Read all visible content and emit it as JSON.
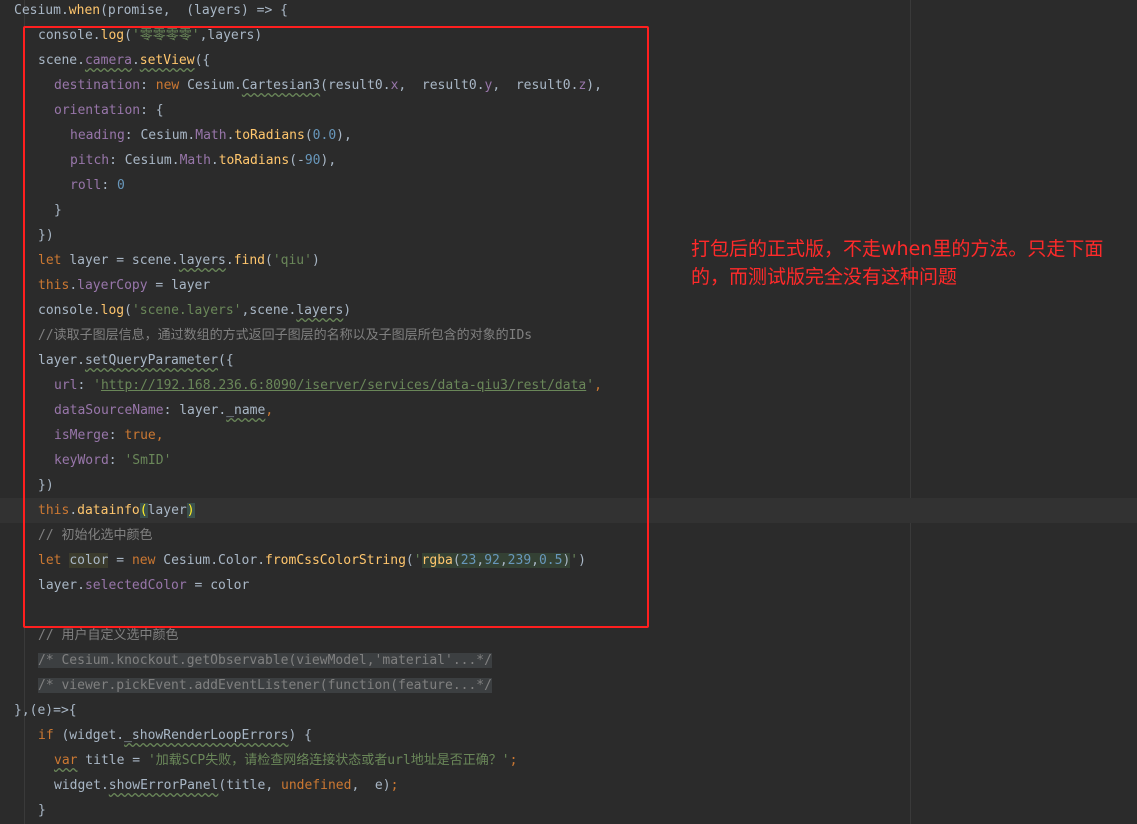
{
  "colors": {
    "background": "#2b2b2b",
    "default": "#a9b7c6",
    "keyword": "#cc7832",
    "string": "#6a8759",
    "number": "#6897bb",
    "method": "#ffc66d",
    "property": "#9876aa",
    "comment": "#808080",
    "annotation": "#ff2a2a",
    "highlight_box": "#ff1f1f"
  },
  "annotation": {
    "text": "打包后的正式版，不走when里的方法。只走下面的，而测试版完全没有这种问题"
  },
  "code_lines": [
    {
      "indent": 1,
      "caret": false,
      "tokens": [
        {
          "t": "Cesium.",
          "c": "default"
        },
        {
          "t": "when",
          "c": "method"
        },
        {
          "t": "(promise,  (layers) => {",
          "c": "default"
        }
      ]
    },
    {
      "indent": 4,
      "caret": false,
      "tokens": [
        {
          "t": "console.",
          "c": "default"
        },
        {
          "t": "log",
          "c": "method"
        },
        {
          "t": "(",
          "c": "default"
        },
        {
          "t": "'零零零零'",
          "c": "string"
        },
        {
          "t": ",layers)",
          "c": "default"
        }
      ]
    },
    {
      "indent": 4,
      "caret": false,
      "tokens": [
        {
          "t": "scene.",
          "c": "default"
        },
        {
          "t": "camera",
          "c": "prop",
          "x": "typo"
        },
        {
          "t": ".",
          "c": "default"
        },
        {
          "t": "setView",
          "c": "method",
          "x": "typo"
        },
        {
          "t": "({",
          "c": "default"
        }
      ]
    },
    {
      "indent": 6,
      "caret": false,
      "tokens": [
        {
          "t": "destination",
          "c": "prop"
        },
        {
          "t": ": ",
          "c": "default"
        },
        {
          "t": "new ",
          "c": "keyword"
        },
        {
          "t": "Cesium.",
          "c": "default"
        },
        {
          "t": "Cartesian3",
          "c": "default",
          "x": "typo"
        },
        {
          "t": "(result0.",
          "c": "default"
        },
        {
          "t": "x",
          "c": "prop"
        },
        {
          "t": ",  result0.",
          "c": "default"
        },
        {
          "t": "y",
          "c": "prop"
        },
        {
          "t": ",  result0.",
          "c": "default"
        },
        {
          "t": "z",
          "c": "prop"
        },
        {
          "t": "),",
          "c": "default"
        }
      ]
    },
    {
      "indent": 6,
      "caret": false,
      "tokens": [
        {
          "t": "orientation",
          "c": "prop"
        },
        {
          "t": ": {",
          "c": "default"
        }
      ]
    },
    {
      "indent": 8,
      "caret": false,
      "tokens": [
        {
          "t": "heading",
          "c": "prop"
        },
        {
          "t": ": Cesium.",
          "c": "default"
        },
        {
          "t": "Math",
          "c": "prop"
        },
        {
          "t": ".",
          "c": "default"
        },
        {
          "t": "toRadians",
          "c": "method"
        },
        {
          "t": "(",
          "c": "default"
        },
        {
          "t": "0.0",
          "c": "number"
        },
        {
          "t": "),",
          "c": "default"
        }
      ]
    },
    {
      "indent": 8,
      "caret": false,
      "tokens": [
        {
          "t": "pitch",
          "c": "prop"
        },
        {
          "t": ": Cesium.",
          "c": "default"
        },
        {
          "t": "Math",
          "c": "prop"
        },
        {
          "t": ".",
          "c": "default"
        },
        {
          "t": "toRadians",
          "c": "method"
        },
        {
          "t": "(-",
          "c": "default"
        },
        {
          "t": "90",
          "c": "number"
        },
        {
          "t": "),",
          "c": "default"
        }
      ]
    },
    {
      "indent": 8,
      "caret": false,
      "tokens": [
        {
          "t": "roll",
          "c": "prop"
        },
        {
          "t": ": ",
          "c": "default"
        },
        {
          "t": "0",
          "c": "number"
        }
      ]
    },
    {
      "indent": 6,
      "caret": false,
      "tokens": [
        {
          "t": "}",
          "c": "default"
        }
      ]
    },
    {
      "indent": 4,
      "caret": false,
      "tokens": [
        {
          "t": "})",
          "c": "default"
        }
      ]
    },
    {
      "indent": 4,
      "caret": false,
      "tokens": [
        {
          "t": "let ",
          "c": "keyword"
        },
        {
          "t": "layer = scene.",
          "c": "default"
        },
        {
          "t": "layers",
          "c": "default",
          "x": "typo"
        },
        {
          "t": ".",
          "c": "default"
        },
        {
          "t": "find",
          "c": "method"
        },
        {
          "t": "(",
          "c": "default"
        },
        {
          "t": "'qiu'",
          "c": "string"
        },
        {
          "t": ")",
          "c": "default"
        }
      ]
    },
    {
      "indent": 4,
      "caret": false,
      "tokens": [
        {
          "t": "this",
          "c": "keyword"
        },
        {
          "t": ".",
          "c": "default"
        },
        {
          "t": "layerCopy",
          "c": "prop"
        },
        {
          "t": " = layer",
          "c": "default"
        }
      ]
    },
    {
      "indent": 4,
      "caret": false,
      "tokens": [
        {
          "t": "console.",
          "c": "default"
        },
        {
          "t": "log",
          "c": "method"
        },
        {
          "t": "(",
          "c": "default"
        },
        {
          "t": "'scene.layers'",
          "c": "string"
        },
        {
          "t": ",scene.",
          "c": "default"
        },
        {
          "t": "layers",
          "c": "default",
          "x": "typo"
        },
        {
          "t": ")",
          "c": "default"
        }
      ]
    },
    {
      "indent": 4,
      "caret": false,
      "tokens": [
        {
          "t": "//读取子图层信息，通过数组的方式返回子图层的名称以及子图层所包含的对象的IDs",
          "c": "comment"
        }
      ]
    },
    {
      "indent": 4,
      "caret": false,
      "tokens": [
        {
          "t": "layer.",
          "c": "default"
        },
        {
          "t": "setQueryParameter",
          "c": "default",
          "x": "typo"
        },
        {
          "t": "({",
          "c": "default"
        }
      ]
    },
    {
      "indent": 6,
      "caret": false,
      "tokens": [
        {
          "t": "url",
          "c": "prop"
        },
        {
          "t": ": ",
          "c": "default"
        },
        {
          "t": "'",
          "c": "string"
        },
        {
          "t": "http://192.168.236.6:8090/iserver/services/data-qiu3/rest/data",
          "c": "url"
        },
        {
          "t": "'",
          "c": "string"
        },
        {
          "t": ",",
          "c": "keyword"
        }
      ]
    },
    {
      "indent": 6,
      "caret": false,
      "tokens": [
        {
          "t": "dataSourceName",
          "c": "prop"
        },
        {
          "t": ": layer.",
          "c": "default"
        },
        {
          "t": "_name",
          "c": "default",
          "x": "typo"
        },
        {
          "t": ",",
          "c": "keyword"
        }
      ]
    },
    {
      "indent": 6,
      "caret": false,
      "tokens": [
        {
          "t": "isMerge",
          "c": "prop"
        },
        {
          "t": ": ",
          "c": "default"
        },
        {
          "t": "true",
          "c": "keyword"
        },
        {
          "t": ",",
          "c": "keyword"
        }
      ]
    },
    {
      "indent": 6,
      "caret": false,
      "tokens": [
        {
          "t": "keyWord",
          "c": "prop"
        },
        {
          "t": ": ",
          "c": "default"
        },
        {
          "t": "'SmID'",
          "c": "string"
        }
      ]
    },
    {
      "indent": 4,
      "caret": false,
      "tokens": [
        {
          "t": "})",
          "c": "default"
        }
      ]
    },
    {
      "indent": 4,
      "caret": true,
      "tokens": [
        {
          "t": "this",
          "c": "keyword"
        },
        {
          "t": ".",
          "c": "default"
        },
        {
          "t": "datainfo",
          "c": "method"
        },
        {
          "t": "(",
          "c": "default",
          "x": "match"
        },
        {
          "t": "layer",
          "c": "default"
        },
        {
          "t": ")",
          "c": "default",
          "x": "match"
        }
      ]
    },
    {
      "indent": 4,
      "caret": false,
      "tokens": [
        {
          "t": "// 初始化选中颜色",
          "c": "comment"
        }
      ]
    },
    {
      "indent": 4,
      "caret": false,
      "tokens": [
        {
          "t": "let ",
          "c": "keyword"
        },
        {
          "t": "color",
          "c": "default",
          "x": "hlvar"
        },
        {
          "t": " = ",
          "c": "default"
        },
        {
          "t": "new ",
          "c": "keyword"
        },
        {
          "t": "Cesium.",
          "c": "default"
        },
        {
          "t": "Color",
          "c": "default"
        },
        {
          "t": ".",
          "c": "default"
        },
        {
          "t": "fromCssColorString",
          "c": "method"
        },
        {
          "t": "(",
          "c": "default"
        },
        {
          "t": "'",
          "c": "string"
        },
        {
          "t": "rgba",
          "c": "method",
          "x": "hl"
        },
        {
          "t": "(",
          "c": "default",
          "x": "hl"
        },
        {
          "t": "23",
          "c": "number",
          "x": "hl"
        },
        {
          "t": ",",
          "c": "default",
          "x": "hl"
        },
        {
          "t": "92",
          "c": "number",
          "x": "hl"
        },
        {
          "t": ",",
          "c": "default",
          "x": "hl"
        },
        {
          "t": "239",
          "c": "number",
          "x": "hl"
        },
        {
          "t": ",",
          "c": "default",
          "x": "hl"
        },
        {
          "t": "0.5",
          "c": "number",
          "x": "hl"
        },
        {
          "t": ")",
          "c": "default",
          "x": "hl"
        },
        {
          "t": "'",
          "c": "string"
        },
        {
          "t": ")",
          "c": "default"
        }
      ]
    },
    {
      "indent": 4,
      "caret": false,
      "tokens": [
        {
          "t": "layer.",
          "c": "default"
        },
        {
          "t": "selectedColor",
          "c": "prop"
        },
        {
          "t": " = color",
          "c": "default"
        }
      ]
    },
    {
      "indent": 0,
      "caret": false,
      "tokens": []
    },
    {
      "indent": 4,
      "caret": false,
      "tokens": [
        {
          "t": "// 用户自定义选中颜色",
          "c": "comment"
        }
      ]
    },
    {
      "indent": 4,
      "caret": false,
      "tokens": [
        {
          "t": "/* Cesium.knockout.getObservable(viewModel,'material'...*/",
          "c": "comment",
          "x": "fold"
        }
      ]
    },
    {
      "indent": 4,
      "caret": false,
      "tokens": [
        {
          "t": "/* viewer.pickEvent.addEventListener(function(feature...*/",
          "c": "comment",
          "x": "fold"
        }
      ]
    },
    {
      "indent": 1,
      "caret": false,
      "tokens": [
        {
          "t": "},(e)=>{",
          "c": "default"
        }
      ]
    },
    {
      "indent": 4,
      "caret": false,
      "tokens": [
        {
          "t": "if ",
          "c": "keyword"
        },
        {
          "t": "(widget.",
          "c": "default"
        },
        {
          "t": "_showRenderLoopErrors",
          "c": "default",
          "x": "typo"
        },
        {
          "t": ") {",
          "c": "default"
        }
      ]
    },
    {
      "indent": 6,
      "caret": false,
      "tokens": [
        {
          "t": "var",
          "c": "keyword",
          "x": "typo"
        },
        {
          "t": " title = ",
          "c": "default"
        },
        {
          "t": "'加载SCP失败，请检查网络连接状态或者url地址是否正确？'",
          "c": "string"
        },
        {
          "t": ";",
          "c": "keyword"
        }
      ]
    },
    {
      "indent": 6,
      "caret": false,
      "tokens": [
        {
          "t": "widget.",
          "c": "default"
        },
        {
          "t": "showErrorPanel",
          "c": "default",
          "x": "typo"
        },
        {
          "t": "(title, ",
          "c": "default"
        },
        {
          "t": "undefined",
          "c": "keyword"
        },
        {
          "t": ",  e)",
          "c": "default"
        },
        {
          "t": ";",
          "c": "keyword"
        }
      ]
    },
    {
      "indent": 4,
      "caret": false,
      "tokens": [
        {
          "t": "}",
          "c": "default"
        }
      ]
    }
  ]
}
